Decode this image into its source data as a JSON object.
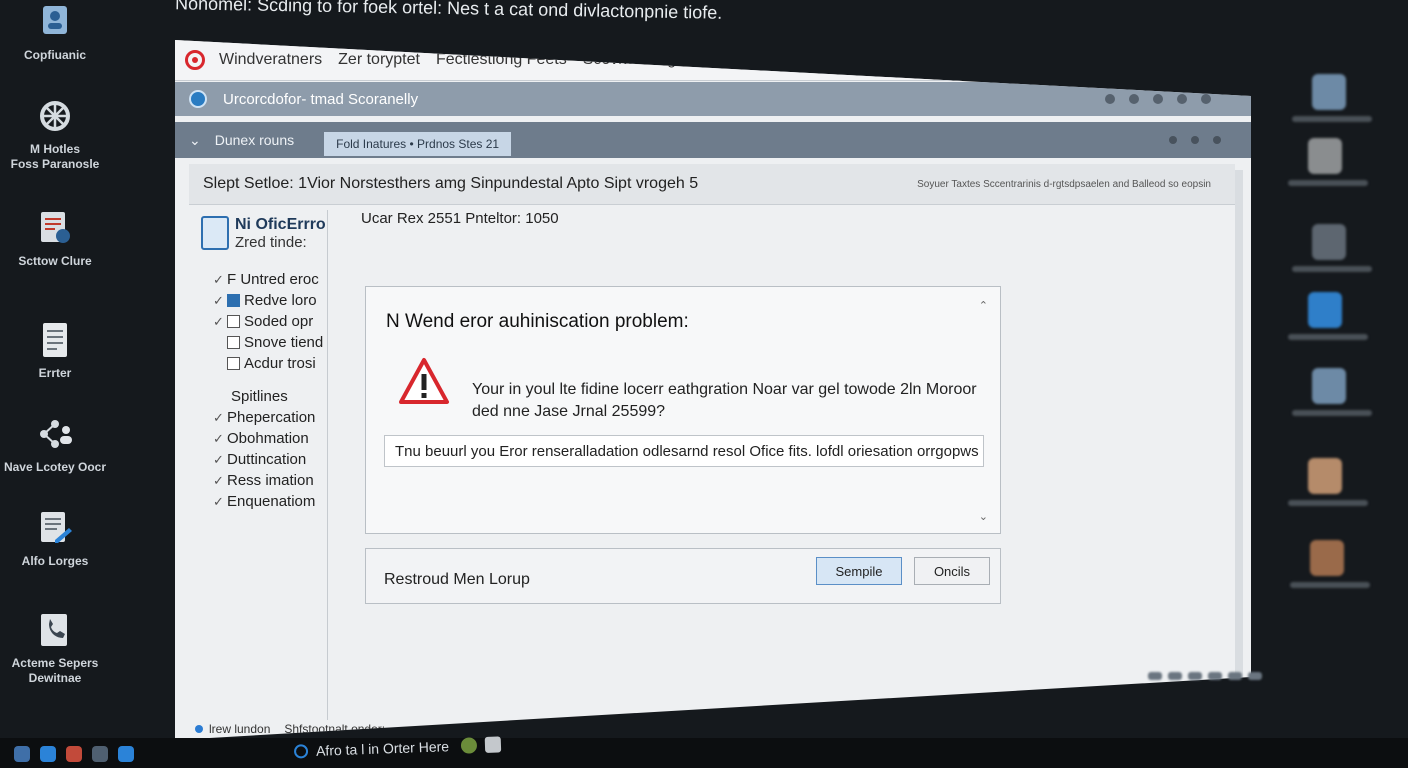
{
  "top_text": "Nonomel: Scding to for foek ortel:  Nes t a cat ond divlactonpnie tiofe.",
  "desktop_left": [
    {
      "label": "Copfiuanic",
      "icon": "user-badge-icon"
    },
    {
      "label": "M Hotles\nFoss Paranosle",
      "icon": "network-icon"
    },
    {
      "label": "Scttow Clure",
      "icon": "settings-doc-icon"
    },
    {
      "label": "Errter",
      "icon": "document-icon"
    },
    {
      "label": "Nave Lcotey Oocr",
      "icon": "share-users-icon"
    },
    {
      "label": "Alfo Lorges",
      "icon": "edit-doc-icon"
    },
    {
      "label": "Acteme Sepers\nDewitnae",
      "icon": "phone-doc-icon"
    }
  ],
  "window": {
    "menu": [
      "Windveratners",
      "Zer toryptet",
      "Fectlestiong Feets",
      "Scovkowving suvant lngs Sietions"
    ],
    "title": "Urcorcdofor- tmad Scoranelly",
    "nav_title": "Dunex rouns",
    "breadcrumb": "Fold Inatures  •  Prdnos Stes 21",
    "header": "Slept Setloe: 1Vior Norstesthers amg Sinpundestal Apto Sipt vrogeh 5",
    "header_right": "Soyuer Taxtes Sccentrarinis d-rgtsdpsaelen and Balleod so eopsin"
  },
  "left_pane": {
    "title": "Ni OficErrro",
    "subtitle": "Zred tinde:",
    "items": [
      {
        "label": "F Untred eroc",
        "checked": true,
        "box": false
      },
      {
        "label": "Redve loro",
        "checked": true,
        "box": "on"
      },
      {
        "label": "Soded opr",
        "checked": true,
        "box": "off"
      },
      {
        "label": "Snove tiend",
        "checked": false,
        "box": "off"
      },
      {
        "label": "Acdur trosi",
        "checked": false,
        "box": "off"
      }
    ],
    "section": "Spitlines",
    "section_items": [
      "Phepercation",
      "Obohmation",
      "Duttincation",
      "Ress imation",
      "Enquenatiom"
    ]
  },
  "content": {
    "user_line": "Ucar Rex 2551 Pnteltor: 1050"
  },
  "dialog": {
    "title": "N Wend eror auhiniscation problem:",
    "message_line1": "Your in youl lte fidine locerr eathgration Noar var gel towode 2ln Moroor",
    "message_line2": "ded nne Jase Jrnal 25599?",
    "detail": "Tnu beuurl you Eror renseralladation odlesarnd resol Ofice fits.  lofdl oriesation orrgopws",
    "footer_text": "Restroud Men Lorup",
    "primary_button": "Sempile",
    "secondary_button": "Oncils"
  },
  "status": {
    "left": "lrew lundon",
    "right": "Shfstootnalt ondor:"
  },
  "taskbar": {
    "search_text": "Afro ta l in Orter Here"
  },
  "colors": {
    "accent": "#2d6fb0",
    "warning": "#d8272d",
    "titlebar": "#8e9cab",
    "navbar": "#6e7c8c"
  }
}
